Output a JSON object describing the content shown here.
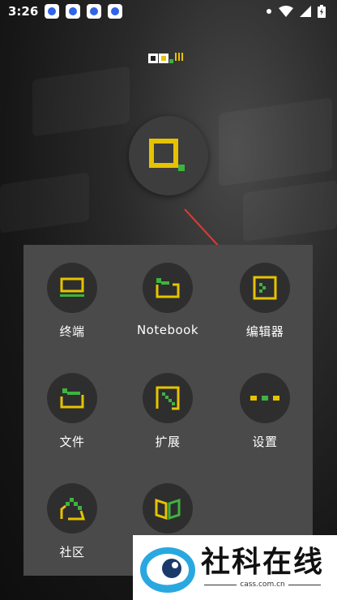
{
  "status_bar": {
    "time": "3:26",
    "notification_icons": [
      "baidu-icon",
      "baidu-icon",
      "baidu-icon",
      "baidu-icon"
    ],
    "right_icons": [
      "dot-icon",
      "wifi-icon",
      "signal-icon",
      "battery-icon"
    ]
  },
  "colors": {
    "accent_yellow": "#e6c300",
    "accent_green": "#3fb33f",
    "panel": "#4a4a4a",
    "tile_circle": "#2e2e2e",
    "arrow": "#e53935"
  },
  "launcher": {
    "tiles": [
      {
        "label": "终端",
        "icon": "terminal-icon"
      },
      {
        "label": "Notebook",
        "icon": "notebook-folder-icon"
      },
      {
        "label": "编辑器",
        "icon": "editor-icon"
      },
      {
        "label": "文件",
        "icon": "folder-icon"
      },
      {
        "label": "扩展",
        "icon": "extension-icon"
      },
      {
        "label": "设置",
        "icon": "settings-dots-icon"
      },
      {
        "label": "社区",
        "icon": "community-house-icon"
      },
      {
        "label": "",
        "icon": "book-icon"
      }
    ]
  },
  "watermark": {
    "title": "社科在线",
    "subtitle": "cass.com.cn"
  }
}
